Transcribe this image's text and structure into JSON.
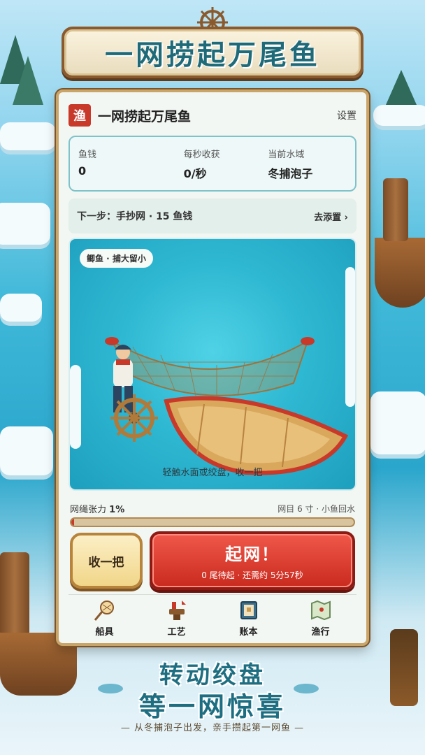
{
  "banner": {
    "title": "一网捞起万尾鱼"
  },
  "header": {
    "icon_char": "渔",
    "app_name": "一网捞起万尾鱼",
    "settings_label": "设置"
  },
  "stats": {
    "money_label": "鱼钱",
    "money_value": "0",
    "rate_label": "每秒收获",
    "rate_value": "0/秒",
    "water_label": "当前水域",
    "water_value": "冬捕泡子"
  },
  "next_step": {
    "text": "下一步：手抄网 · 15 鱼钱",
    "link_label": "去添置 ›"
  },
  "scene": {
    "tag": "鲫鱼 · 捕大留小",
    "hint": "轻触水面或绞盘，收一把"
  },
  "tension": {
    "label": "网绳张力",
    "value": "1%",
    "percent": 1,
    "mesh_info": "网目 6 寸 · 小鱼回水"
  },
  "actions": {
    "collect_label": "收一把",
    "haul_label": "起网！",
    "haul_sub": "0 尾待起 · 还需约 5分57秒"
  },
  "nav": {
    "items": [
      {
        "label": "船具",
        "icon": "scoop-net-icon"
      },
      {
        "label": "工艺",
        "icon": "anvil-icon"
      },
      {
        "label": "账本",
        "icon": "ledger-icon"
      },
      {
        "label": "渔行",
        "icon": "map-icon"
      }
    ]
  },
  "footer": {
    "slogan_line1": "转动绞盘",
    "slogan_line2": "等一网惊喜",
    "tagline": "— 从冬捕泡子出发，亲手攒起第一网鱼 —"
  },
  "colors": {
    "accent_red": "#c92a1e",
    "title_teal": "#1f6a78",
    "frame_gold": "#c9a56a"
  }
}
